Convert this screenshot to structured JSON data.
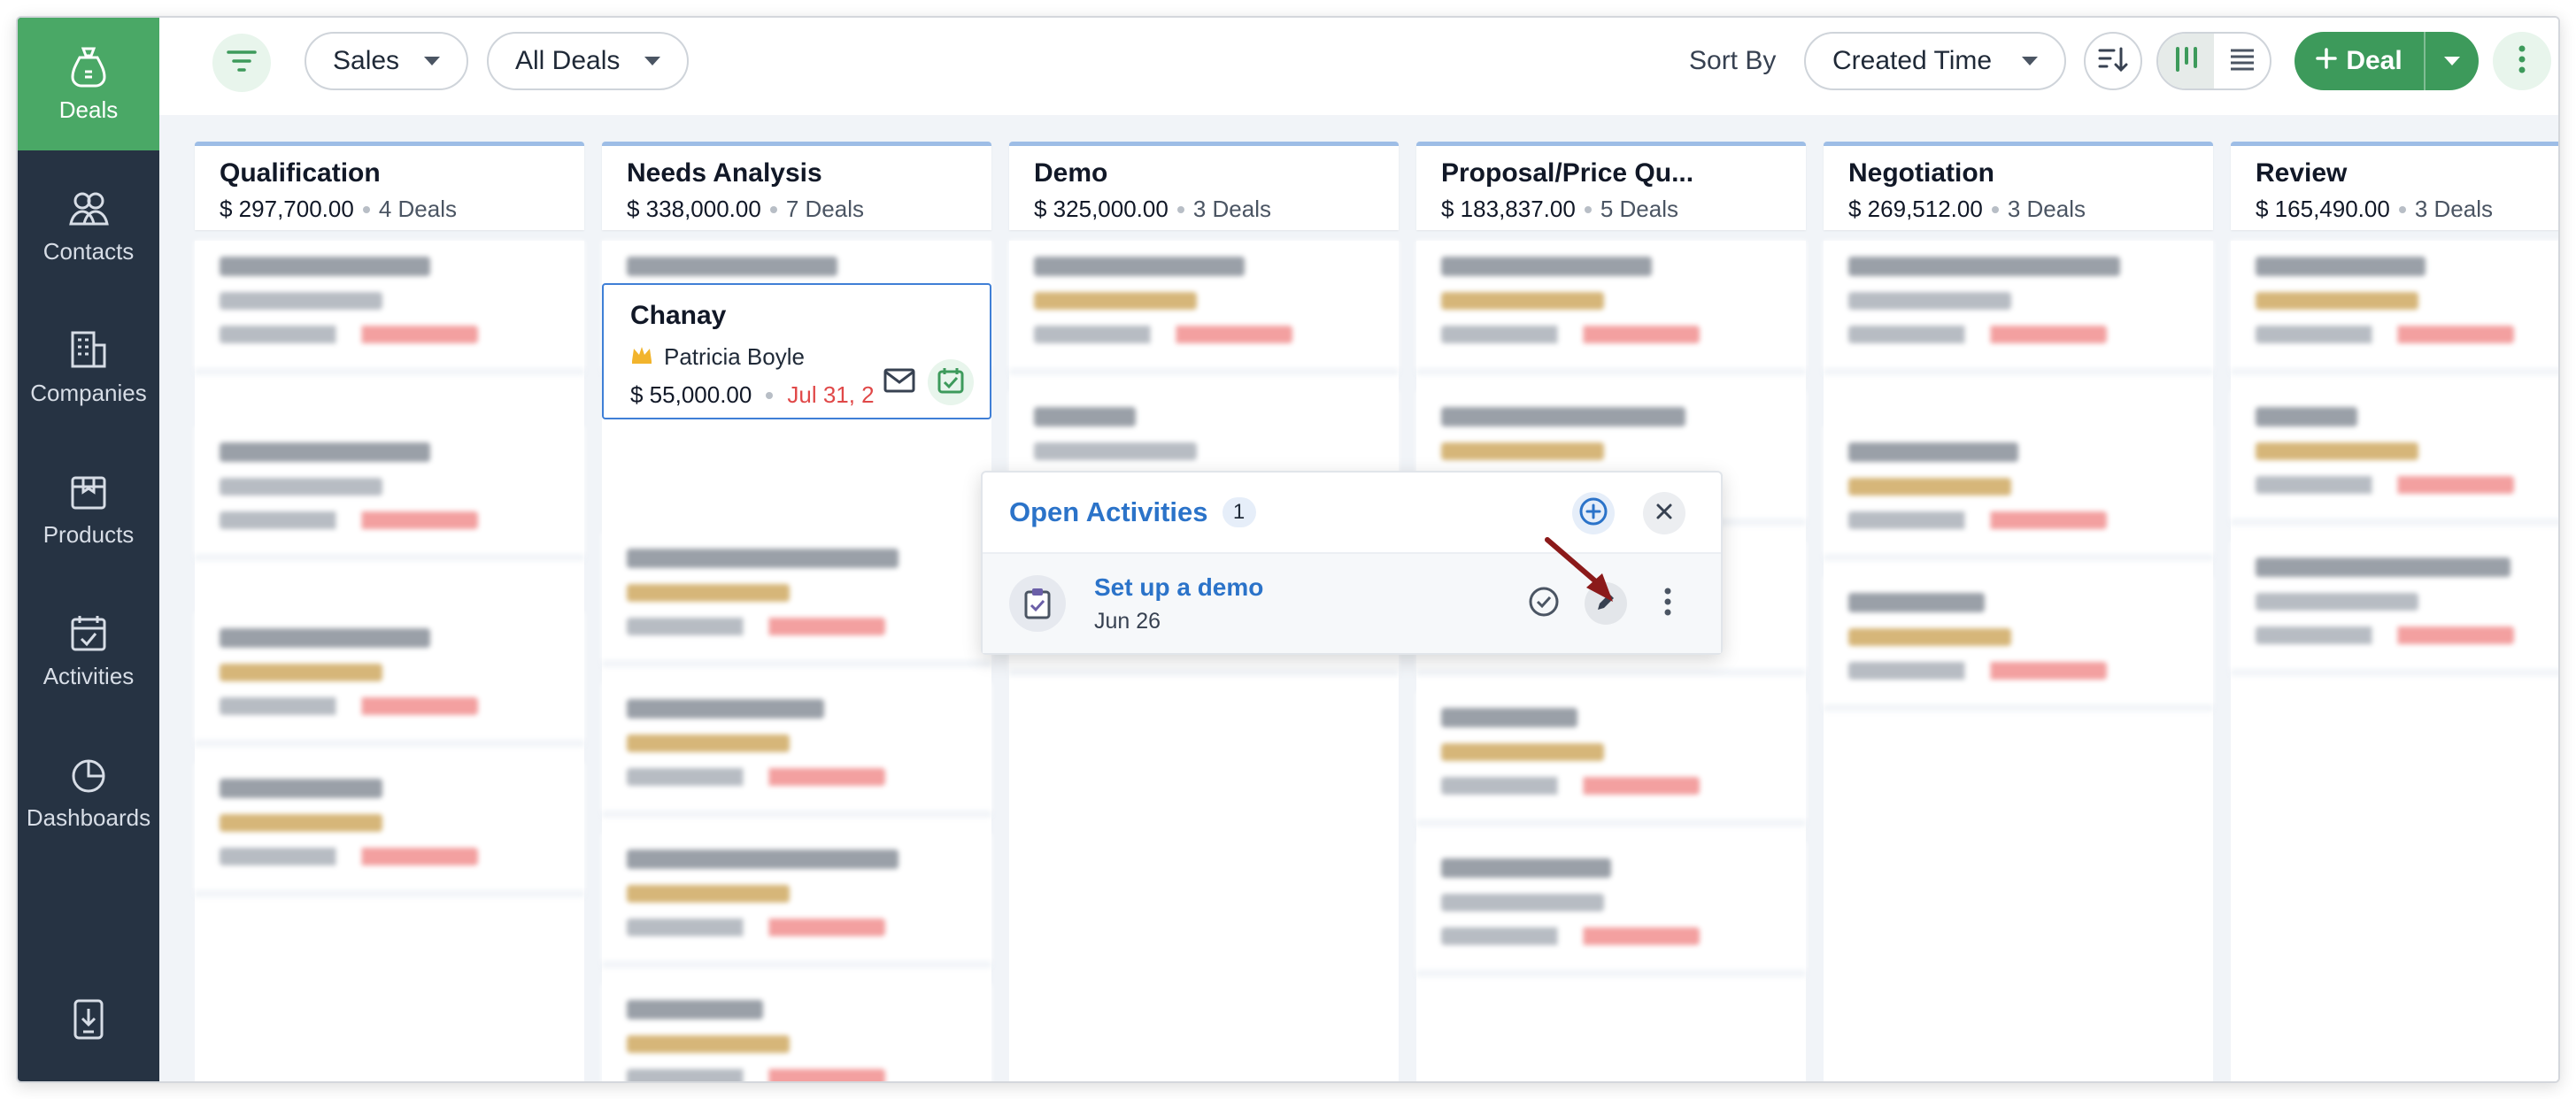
{
  "sidebar": {
    "items": [
      {
        "label": "Deals",
        "icon": "deals-icon",
        "active": true
      },
      {
        "label": "Contacts",
        "icon": "contacts-icon"
      },
      {
        "label": "Companies",
        "icon": "companies-icon"
      },
      {
        "label": "Products",
        "icon": "products-icon"
      },
      {
        "label": "Activities",
        "icon": "activities-icon"
      },
      {
        "label": "Dashboards",
        "icon": "dashboards-icon"
      }
    ]
  },
  "toolbar": {
    "pipeline_value": "Sales",
    "view_value": "All Deals",
    "sort_label": "Sort By",
    "sort_value": "Created Time",
    "new_deal_label": "Deal"
  },
  "columns": [
    {
      "title": "Qualification",
      "amount": "$ 297,700.00",
      "count": "4 Deals"
    },
    {
      "title": "Needs Analysis",
      "amount": "$ 338,000.00",
      "count": "7 Deals"
    },
    {
      "title": "Demo",
      "amount": "$ 325,000.00",
      "count": "3 Deals"
    },
    {
      "title": "Proposal/Price Qu...",
      "amount": "$ 183,837.00",
      "count": "5 Deals"
    },
    {
      "title": "Negotiation",
      "amount": "$ 269,512.00",
      "count": "3 Deals"
    },
    {
      "title": "Review",
      "amount": "$ 165,490.00",
      "count": "3 Deals"
    }
  ],
  "active_deal": {
    "name": "Chanay",
    "owner": "Patricia Boyle",
    "amount": "$ 55,000.00",
    "closing_date": "Jul 31, 2"
  },
  "popover": {
    "title": "Open Activities",
    "count": "1",
    "activity": {
      "title": "Set up a demo",
      "date": "Jun 26"
    }
  },
  "colors": {
    "sidebar_bg": "#263343",
    "accent_green": "#4aa866",
    "link_blue": "#2b73c9",
    "overdue_red": "#e04848",
    "annotation_arrow": "#8b1a1a"
  }
}
